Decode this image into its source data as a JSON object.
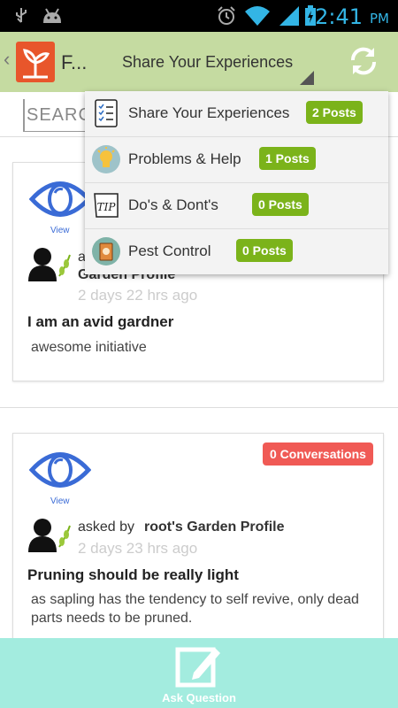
{
  "status_bar": {
    "time": "2:41",
    "ampm": "PM"
  },
  "action_bar": {
    "app_name": "F...",
    "selected_category": "Share Your Experiences"
  },
  "search": {
    "placeholder": "SEARCH"
  },
  "dropdown": {
    "items": [
      {
        "label": "Share Your Experiences",
        "badge": "2 Posts",
        "icon": "checklist-icon"
      },
      {
        "label": "Problems & Help",
        "badge": "1 Posts",
        "icon": "lightbulb-icon"
      },
      {
        "label": "Do's & Dont's",
        "badge": "0 Posts",
        "icon": "tip-icon"
      },
      {
        "label": "Pest Control",
        "badge": "0 Posts",
        "icon": "pest-control-icon"
      }
    ]
  },
  "posts": [
    {
      "view_label": "View",
      "asked_prefix": "a",
      "profile": "Garden Profile",
      "posted": "2 days 22 hrs ago",
      "title": "I am an avid gardner",
      "body": "awesome initiative"
    },
    {
      "view_label": "View",
      "conversations": "0 Conversations",
      "asked_prefix": "asked by",
      "profile": "root's Garden Profile",
      "posted": "2 days 23 hrs ago",
      "title": "Pruning should be really light",
      "body": "as sapling has the tendency to self revive, only dead parts needs to be pruned."
    }
  ],
  "bottom_bar": {
    "ask_label": "Ask Question"
  },
  "colors": {
    "action_bar": "#c5dba1",
    "badge_green": "#7bb31a",
    "badge_red": "#f05a55",
    "bottom_bar": "#a3ecdf",
    "eye_blue": "#3a6bd6"
  }
}
